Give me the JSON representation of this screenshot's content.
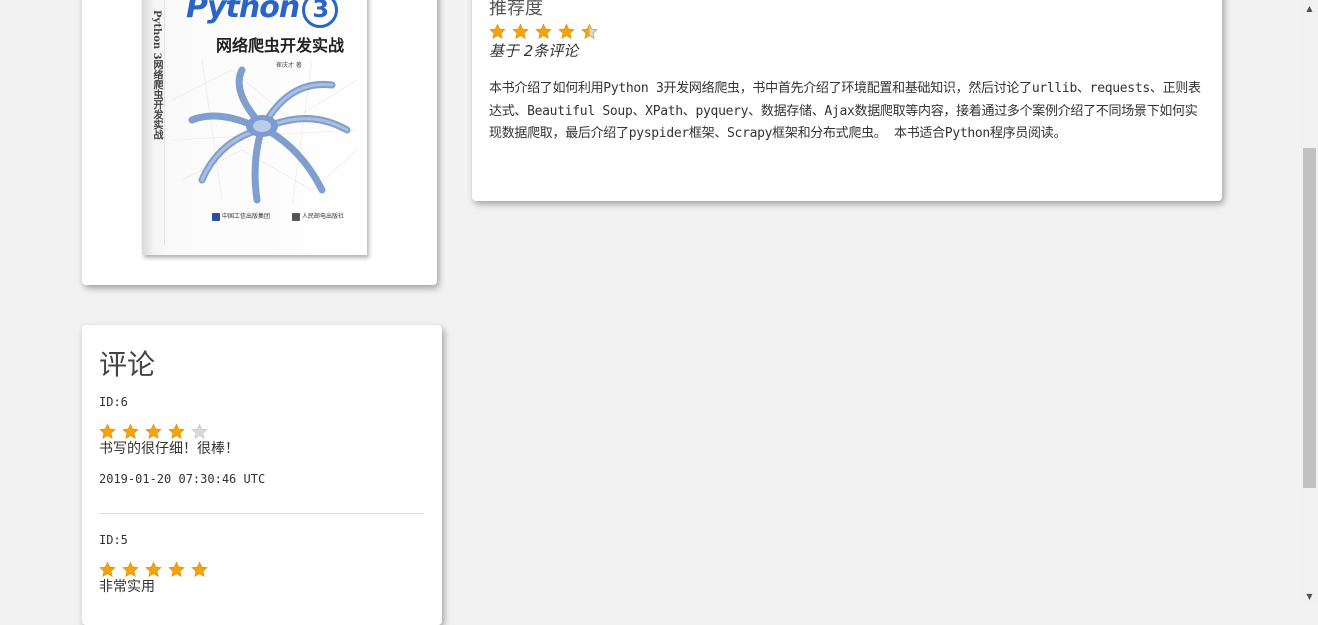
{
  "book": {
    "cover": {
      "title_en": "Python",
      "title_num": "3",
      "title_cn": "网络爬虫开发实战",
      "author": "崔庆才 著",
      "spine_text": "Python 3网络爬虫开发实战",
      "publisher_1": "中国工信出版集团",
      "publisher_2": "人民邮电出版社"
    }
  },
  "detail": {
    "rec_label": "推荐度",
    "rating": 4.5,
    "based_on": "基于 2条评论",
    "description": "本书介绍了如何利用Python 3开发网络爬虫，书中首先介绍了环境配置和基础知识，然后讨论了urllib、requests、正则表达式、Beautiful Soup、XPath、pyquery、数据存储、Ajax数据爬取等内容，接着通过多个案例介绍了不同场景下如何实现数据爬取，最后介绍了pyspider框架、Scrapy框架和分布式爬虫。 本书适合Python程序员阅读。"
  },
  "reviews": {
    "title": "评论",
    "items": [
      {
        "id": "ID:6",
        "rating": 4,
        "text": "书写的很仔细！很棒！",
        "date": "2019-01-20 07:30:46 UTC"
      },
      {
        "id": "ID:5",
        "rating": 5,
        "text": "非常实用",
        "date": ""
      }
    ]
  },
  "colors": {
    "star_filled": "#f5a30a",
    "star_empty": "#d9d9d9",
    "background": "#f2f2f2"
  },
  "icons": [
    "star-icon",
    "spider-illustration",
    "scroll-up-icon",
    "scroll-down-icon"
  ]
}
